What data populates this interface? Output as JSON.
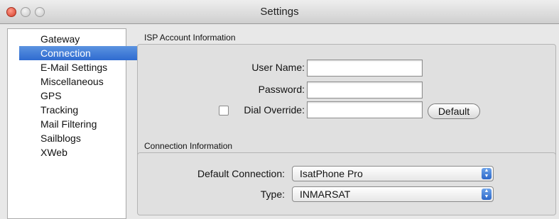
{
  "window": {
    "title": "Settings"
  },
  "sidebar": {
    "items": [
      {
        "label": "Gateway",
        "selected": false
      },
      {
        "label": "Connection",
        "selected": true
      },
      {
        "label": "E-Mail Settings",
        "selected": false
      },
      {
        "label": "Miscellaneous",
        "selected": false
      },
      {
        "label": "GPS",
        "selected": false
      },
      {
        "label": "Tracking",
        "selected": false
      },
      {
        "label": "Mail Filtering",
        "selected": false
      },
      {
        "label": "Sailblogs",
        "selected": false
      },
      {
        "label": "XWeb",
        "selected": false
      }
    ]
  },
  "isp": {
    "title": "ISP Account Information",
    "user_label": "User Name:",
    "user_value": "",
    "password_label": "Password:",
    "password_value": "",
    "dial_override_label": "Dial Override:",
    "dial_override_checked": false,
    "dial_override_value": "",
    "default_button": "Default"
  },
  "conn": {
    "title": "Connection Information",
    "default_label": "Default Connection:",
    "default_value": "IsatPhone Pro",
    "type_label": "Type:",
    "type_value": "INMARSAT"
  },
  "colors": {
    "selection": "#3c78d8",
    "close_button": "#d43b28"
  },
  "icons": {
    "traffic_lights": [
      "close-icon",
      "minimize-icon",
      "zoom-icon"
    ],
    "select_arrows": "updown-arrows-icon"
  }
}
